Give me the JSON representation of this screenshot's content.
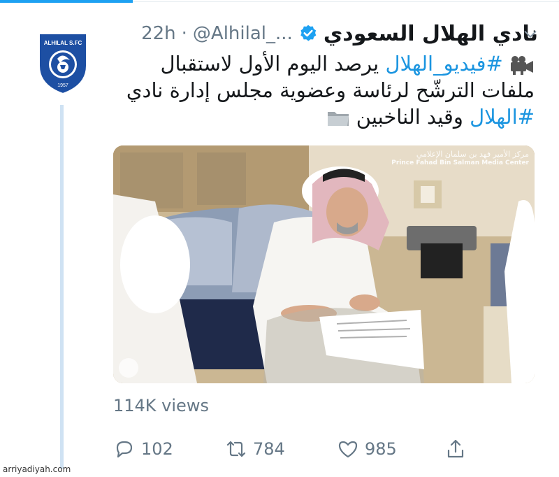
{
  "tweet": {
    "display_name": "نادي الهلال السعودي",
    "handle": "@Alhilal_...",
    "separator": "·",
    "time": "22h",
    "text_lines": {
      "l1_hashtag": "#فيديو_الهلال",
      "l1_rest": " يرصد اليوم الأول لاستقبال",
      "l2": "ملفات الترشّح لرئاسة وعضوية مجلس إدارة نادي",
      "l3_hashtag": "#الهلال",
      "l3_rest": " وقيد الناخبين"
    },
    "media_watermark_ar": "مركز الأمير فهد بن سلمان الإعلامي",
    "media_watermark_en": "Prince Fahad Bin Salman Media Center",
    "views": "114K views",
    "actions": {
      "reply_count": "102",
      "retweet_count": "784",
      "like_count": "985"
    },
    "icons": [
      "verified-icon",
      "chevron-down-icon",
      "movie-camera-icon",
      "folder-icon",
      "reply-icon",
      "retweet-icon",
      "like-icon",
      "share-icon"
    ]
  },
  "avatar_logo": {
    "top_text": "ALHILAL S.FC",
    "year": "1957"
  },
  "site_credit": "arriyadiyah.com",
  "colors": {
    "accent": "#1da1f2",
    "hashtag": "#1b95e0",
    "muted": "#657786",
    "thread": "#cfe2f3",
    "logo_blue": "#1d4fa3"
  }
}
